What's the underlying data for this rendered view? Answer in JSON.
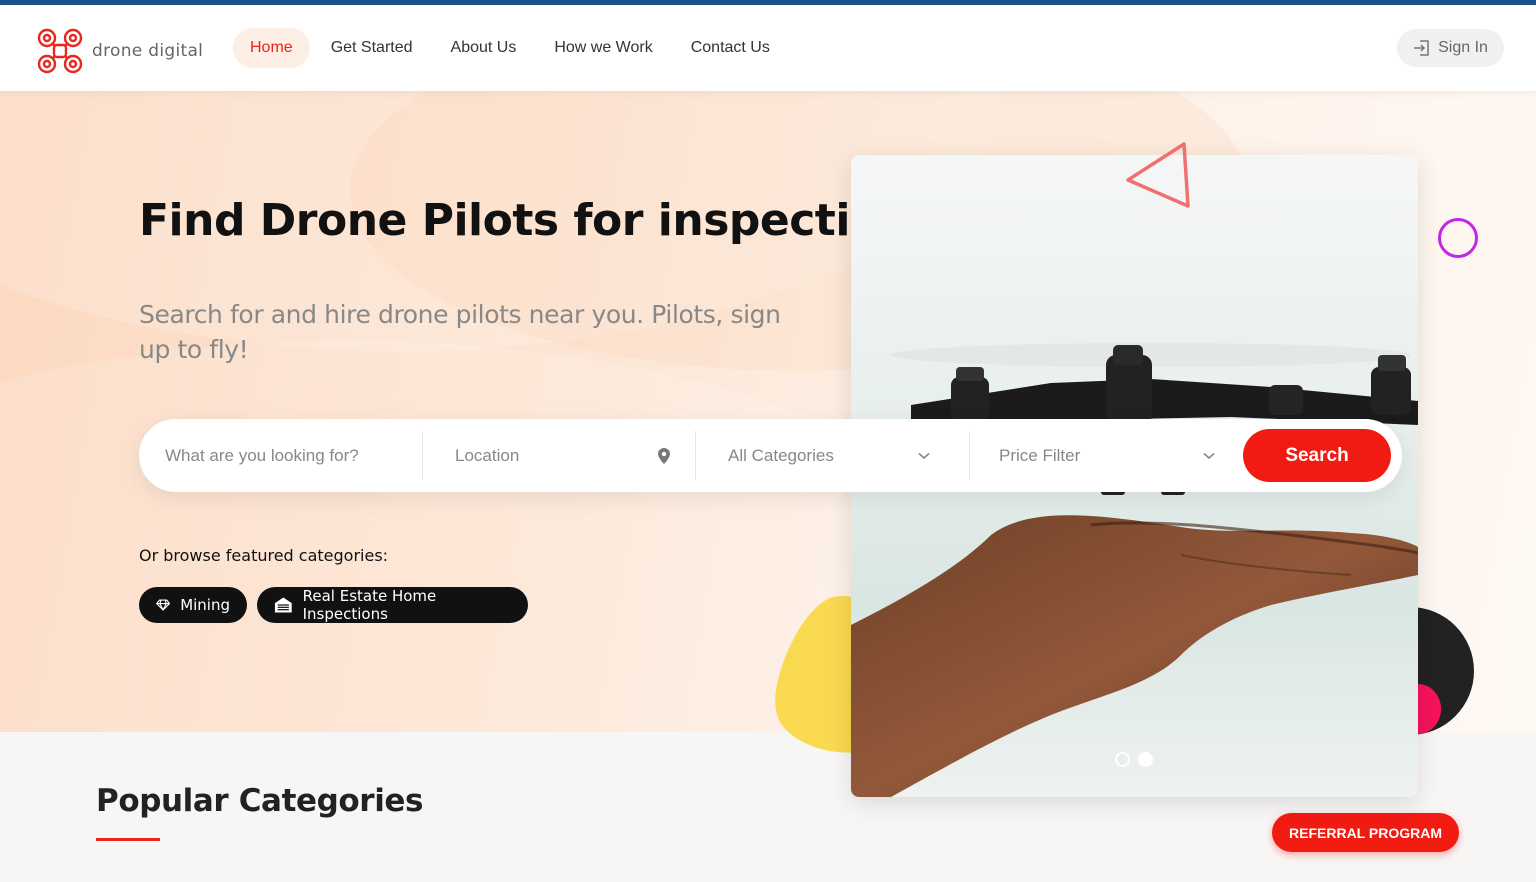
{
  "brand": {
    "name": "drone digital",
    "accent": "#f11b12",
    "topline": "#1e4f8f"
  },
  "nav": {
    "items": [
      {
        "label": "Home",
        "active": true
      },
      {
        "label": "Get Started"
      },
      {
        "label": "About Us"
      },
      {
        "label": "How we Work"
      },
      {
        "label": "Contact Us"
      }
    ],
    "signin_label": "Sign In"
  },
  "hero": {
    "title": "Find Drone Pilots for inspections",
    "subtitle": "Search for and hire drone pilots near you. Pilots, sign up to fly!"
  },
  "search": {
    "keyword_placeholder": "What are you looking for?",
    "location_placeholder": "Location",
    "category_value": "All Categories",
    "price_value": "Price Filter",
    "button_label": "Search"
  },
  "featured": {
    "label": "Or browse featured categories:",
    "chips": [
      {
        "label": "Mining",
        "icon": "diamond-icon"
      },
      {
        "label": "Real Estate Home Inspections",
        "icon": "garage-icon"
      }
    ]
  },
  "slider": {
    "count": 2,
    "active_index": 1
  },
  "popular": {
    "title": "Popular Categories"
  },
  "referral": {
    "label": "REFERRAL PROGRAM"
  }
}
